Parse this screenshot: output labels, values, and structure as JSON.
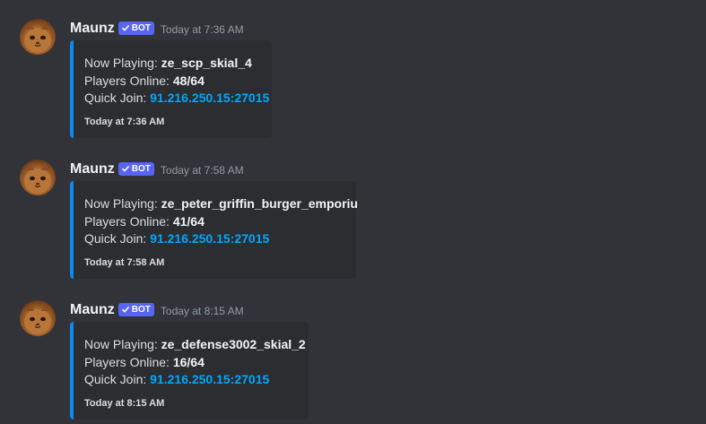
{
  "theme": {
    "background": "#313338",
    "embed_background": "#2b2d31",
    "embed_accent": "#0b89f0",
    "link_color": "#00a8fc",
    "bot_tag_color": "#5865f2"
  },
  "messages": [
    {
      "author": "Maunz",
      "bot_tag": "BOT",
      "timestamp": "Today at 7:36 AM",
      "embed": {
        "now_playing_label": "Now Playing: ",
        "map": "ze_scp_skial_4",
        "players_label": "Players Online: ",
        "players": "48/64",
        "quick_join_label": "Quick Join: ",
        "address": "91.216.250.15:27015",
        "footer": "Today at 7:36 AM"
      }
    },
    {
      "author": "Maunz",
      "bot_tag": "BOT",
      "timestamp": "Today at 7:58 AM",
      "embed": {
        "now_playing_label": "Now Playing: ",
        "map": "ze_peter_griffin_burger_emporiu",
        "players_label": "Players Online: ",
        "players": "41/64",
        "quick_join_label": "Quick Join: ",
        "address": "91.216.250.15:27015",
        "footer": "Today at 7:58 AM"
      }
    },
    {
      "author": "Maunz",
      "bot_tag": "BOT",
      "timestamp": "Today at 8:15 AM",
      "embed": {
        "now_playing_label": "Now Playing: ",
        "map": "ze_defense3002_skial_2",
        "players_label": "Players Online: ",
        "players": "16/64",
        "quick_join_label": "Quick Join: ",
        "address": "91.216.250.15:27015",
        "footer": "Today at 8:15 AM"
      }
    }
  ]
}
